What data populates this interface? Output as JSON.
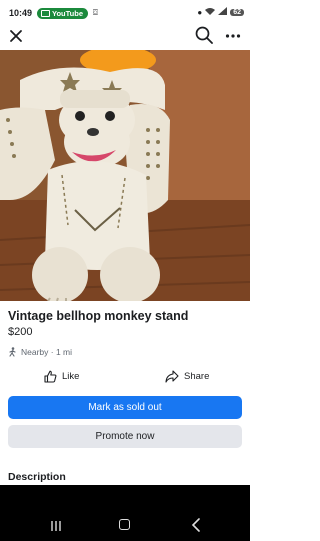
{
  "status_bar": {
    "time": "10:49",
    "youtube_label": "YouTube",
    "battery": "62"
  },
  "listing": {
    "title": "Vintage bellhop monkey stand",
    "price": "$200",
    "location": "Nearby · 1 mi"
  },
  "actions": {
    "like_label": "Like",
    "share_label": "Share"
  },
  "buttons": {
    "mark_sold_label": "Mark as sold out",
    "promote_label": "Promote now"
  },
  "sections": {
    "description_heading": "Description"
  },
  "icons": {
    "close": "close-icon",
    "search": "search-icon",
    "more": "more-icon",
    "location": "walking-person-icon",
    "like": "thumbs-up-icon",
    "share": "share-arrow-icon"
  },
  "colors": {
    "accent": "#1877f2",
    "secondary_button": "#e4e6eb",
    "status_green": "#1b8a3c"
  }
}
